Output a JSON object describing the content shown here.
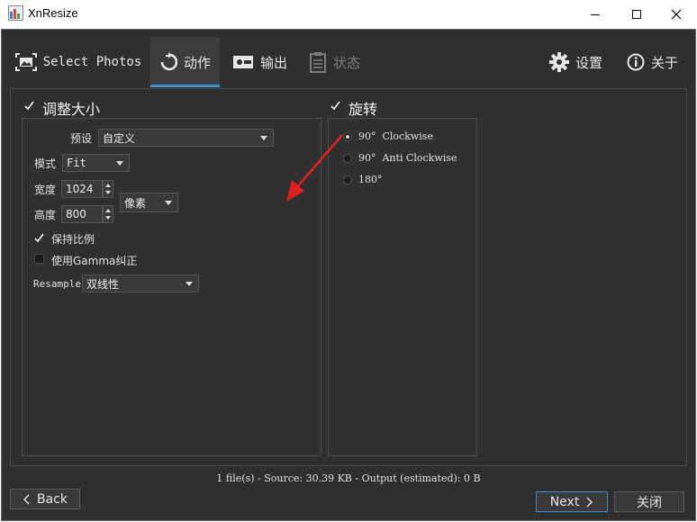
{
  "window": {
    "title": "XnResize"
  },
  "toolbar": {
    "tabs": [
      {
        "label": "Select Photos"
      },
      {
        "label": "动作"
      },
      {
        "label": "输出"
      },
      {
        "label": "状态"
      }
    ],
    "settings_label": "设置",
    "about_label": "关于"
  },
  "resize": {
    "title": "调整大小",
    "checked": true,
    "preset_label": "预设",
    "preset_value": "自定义",
    "mode_label": "模式",
    "mode_value": "Fit",
    "width_label": "宽度",
    "width_value": "1024",
    "height_label": "高度",
    "height_value": "800",
    "unit_value": "像素",
    "keep_ratio_label": "保持比例",
    "keep_ratio_checked": true,
    "gamma_label": "使用Gamma纠正",
    "gamma_checked": false,
    "resample_label": "Resample",
    "resample_value": "双线性"
  },
  "rotate": {
    "title": "旋转",
    "checked": true,
    "options": [
      {
        "label": "90°  Clockwise",
        "selected": true
      },
      {
        "label": "90°  Anti Clockwise",
        "selected": false
      },
      {
        "label": "180°",
        "selected": false
      }
    ]
  },
  "status_text": "1 file(s) - Source: 30.39 KB - Output (estimated): 0 B",
  "buttons": {
    "back": "Back",
    "next": "Next",
    "close": "关闭"
  },
  "colors": {
    "accent": "#3d8fc9",
    "annotation_arrow": "#e02020",
    "background": "#2f2f2f"
  }
}
